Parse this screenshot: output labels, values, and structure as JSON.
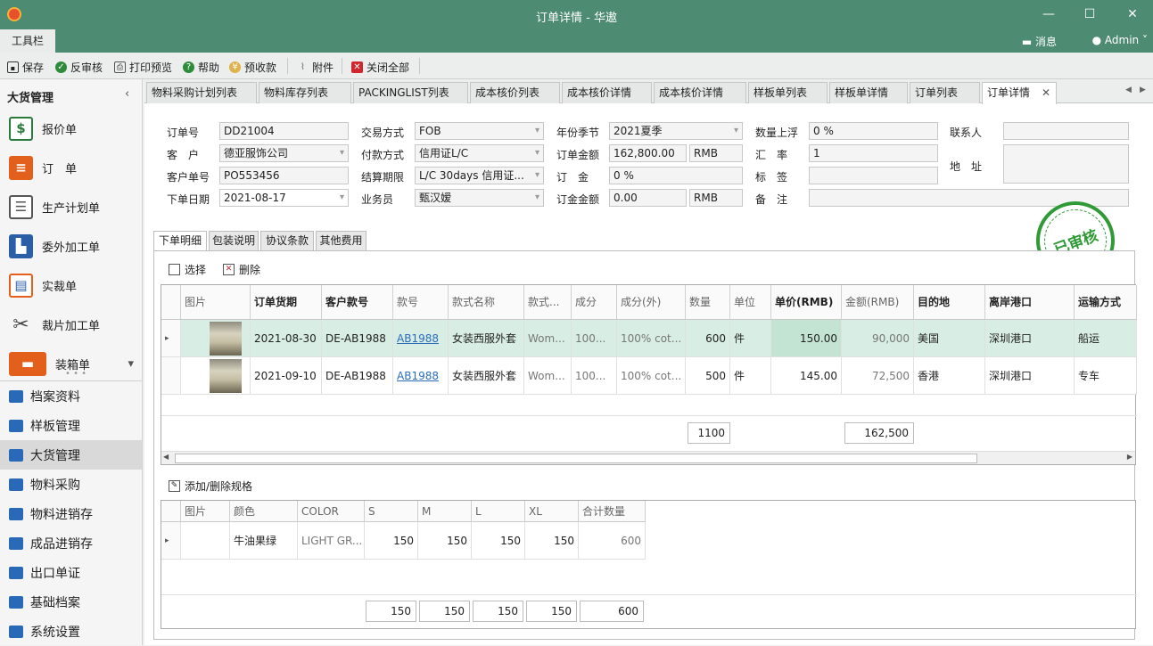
{
  "window": {
    "title": "订单详情 - 华遨"
  },
  "menubar": {
    "tab": "工具栏",
    "messages": "消息",
    "user": "Admin"
  },
  "toolbar": {
    "save": "保存",
    "unapprove": "反审核",
    "print_preview": "打印预览",
    "help": "帮助",
    "prepayment": "预收款",
    "attachment": "附件",
    "close_all": "关闭全部"
  },
  "sidebar": {
    "title": "大货管理",
    "modules": [
      {
        "label": "报价单",
        "icon": "dollar-doc-icon"
      },
      {
        "label": "订　单",
        "icon": "clipboard-icon"
      },
      {
        "label": "生产计划单",
        "icon": "checklist-icon"
      },
      {
        "label": "委外加工单",
        "icon": "factory-icon"
      },
      {
        "label": "实裁单",
        "icon": "doc-ruler-icon"
      },
      {
        "label": "裁片加工单",
        "icon": "scissors-icon"
      },
      {
        "label": "装箱单",
        "icon": "box-icon"
      }
    ],
    "nav": [
      {
        "label": "档案资料",
        "icon": "shirt-icon"
      },
      {
        "label": "样板管理",
        "icon": "shirt-icon"
      },
      {
        "label": "大货管理",
        "icon": "list-icon"
      },
      {
        "label": "物料采购",
        "icon": "cart-icon"
      },
      {
        "label": "物料进销存",
        "icon": "home-icon"
      },
      {
        "label": "成品进销存",
        "icon": "home-icon"
      },
      {
        "label": "出口单证",
        "icon": "card-icon"
      },
      {
        "label": "基础档案",
        "icon": "puzzle-icon"
      },
      {
        "label": "系统设置",
        "icon": "tools-icon"
      }
    ],
    "active_nav": "大货管理"
  },
  "doc_tabs": [
    "物料采购计划列表",
    "物料库存列表",
    "PACKINGLIST列表",
    "成本核价列表",
    "成本核价详情",
    "成本核价详情",
    "样板单列表",
    "样板单详情",
    "订单列表",
    "订单详情"
  ],
  "form": {
    "order_no_label": "订单号",
    "order_no": "DD21004",
    "customer_label": "客　户",
    "customer": "德亚服饰公司",
    "customer_order_label": "客户单号",
    "customer_order": "PO553456",
    "order_date_label": "下单日期",
    "order_date": "2021-08-17",
    "trade_mode_label": "交易方式",
    "trade_mode": "FOB",
    "payment_label": "付款方式",
    "payment": "信用证L/C",
    "settle_label": "结算期限",
    "settle": "L/C 30days 信用证...",
    "salesman_label": "业务员",
    "salesman": "甄汉嫒",
    "season_label": "年份季节",
    "season": "2021夏季",
    "amount_label": "订单金额",
    "amount": "162,800.00",
    "amount_cur": "RMB",
    "deposit_label": "订　金",
    "deposit": "0 %",
    "deposit_amount_label": "订金金额",
    "deposit_amount": "0.00",
    "deposit_cur": "RMB",
    "qty_float_label": "数量上浮",
    "qty_float": "0 %",
    "rate_label": "汇　率",
    "rate": "1",
    "tag_label": "标　签",
    "tag": "",
    "note_label": "备　注",
    "note": "",
    "contact_label": "联系人",
    "contact": "",
    "address_label": "地　址",
    "address": ""
  },
  "stamp": {
    "text": "已审核",
    "color": "#2f9a36"
  },
  "sub_tabs": [
    "下单明细",
    "包装说明",
    "协议条款",
    "其他费用"
  ],
  "detail_actions": {
    "select": "选择",
    "delete": "删除"
  },
  "detail_grid": {
    "headers": [
      "图片",
      "订单货期",
      "客户款号",
      "款号",
      "款式名称",
      "款式...",
      "成分",
      "成分(外)",
      "数量",
      "单位",
      "单价(RMB)",
      "金额(RMB)",
      "目的地",
      "离岸港口",
      "运输方式"
    ],
    "rows": [
      [
        "",
        "2021-08-30",
        "DE-AB1988",
        "AB1988",
        "女装西服外套",
        "Wom...",
        "100...",
        "100% cot...",
        "600",
        "件",
        "150.00",
        "90,000",
        "美国",
        "深圳港口",
        "船运"
      ],
      [
        "",
        "2021-09-10",
        "DE-AB1988",
        "AB1988",
        "女装西服外套",
        "Wom...",
        "100...",
        "100% cot...",
        "500",
        "件",
        "145.00",
        "72,500",
        "香港",
        "深圳港口",
        "专车"
      ]
    ],
    "sum_qty": "1100",
    "sum_amount": "162,500"
  },
  "spec": {
    "add_label": "添加/删除规格",
    "headers": [
      "图片",
      "颜色",
      "COLOR",
      "S",
      "M",
      "L",
      "XL",
      "合计数量"
    ],
    "row": [
      "",
      "牛油果绿",
      "LIGHT GR...",
      "150",
      "150",
      "150",
      "150",
      "600"
    ],
    "sums": [
      "150",
      "150",
      "150",
      "150",
      "600"
    ]
  }
}
